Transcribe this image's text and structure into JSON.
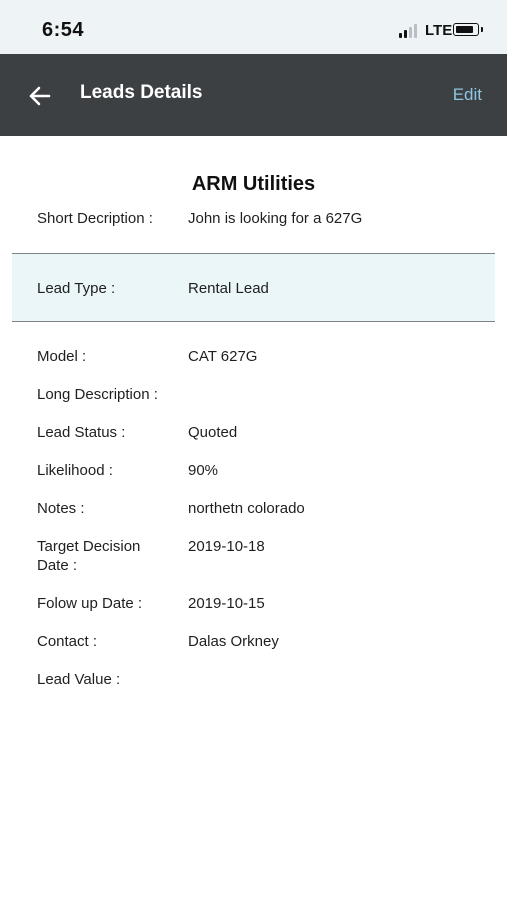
{
  "status_bar": {
    "time": "6:54",
    "network": "LTE",
    "signal_icon": "signal-bars-icon",
    "battery_icon": "battery-icon",
    "battery_level": 0.85
  },
  "header": {
    "back_icon": "arrow-left-icon",
    "title": "Leads Details",
    "edit_label": "Edit"
  },
  "lead": {
    "company": "ARM Utilities",
    "short_description": {
      "label": "Short Decription :",
      "value": "John is looking for a 627G"
    },
    "lead_type": {
      "label": "Lead Type :",
      "value": "Rental Lead"
    },
    "model": {
      "label": "Model :",
      "value": "CAT 627G"
    },
    "long_description": {
      "label": "Long Description :",
      "value": ""
    },
    "lead_status": {
      "label": "Lead Status :",
      "value": "Quoted"
    },
    "likelihood": {
      "label": "Likelihood :",
      "value": "90%"
    },
    "notes": {
      "label": "Notes :",
      "value": "northetn colorado"
    },
    "target_decision_date": {
      "label": "Target Decision Date :",
      "value": "2019-10-18"
    },
    "follow_up_date": {
      "label": "Folow up Date :",
      "value": "2019-10-15"
    },
    "contact": {
      "label": "Contact :",
      "value": "Dalas Orkney"
    },
    "lead_value": {
      "label": "Lead Value :",
      "value": ""
    }
  },
  "colors": {
    "header_bg": "#3c4043",
    "edit_link": "#8cc6e3",
    "highlight_bg": "#eaf6f7"
  }
}
